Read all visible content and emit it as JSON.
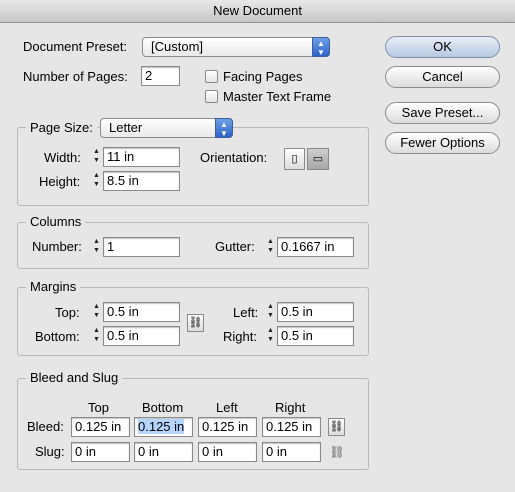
{
  "window": {
    "title": "New Document"
  },
  "document": {
    "preset_label": "Document Preset:",
    "preset_value": "[Custom]",
    "pages_label": "Number of Pages:",
    "pages_value": "2",
    "facing_pages_label": "Facing Pages",
    "facing_pages_checked": false,
    "master_text_frame_label": "Master Text Frame",
    "master_text_frame_checked": false
  },
  "buttons": {
    "ok": "OK",
    "cancel": "Cancel",
    "save_preset": "Save Preset...",
    "fewer_options": "Fewer Options"
  },
  "page_size": {
    "group_title": "Page Size:",
    "value": "Letter",
    "width_label": "Width:",
    "width_value": "11 in",
    "height_label": "Height:",
    "height_value": "8.5 in",
    "orientation_label": "Orientation:",
    "orientation_selected": "landscape"
  },
  "columns": {
    "group_title": "Columns",
    "number_label": "Number:",
    "number_value": "1",
    "gutter_label": "Gutter:",
    "gutter_value": "0.1667 in"
  },
  "margins": {
    "group_title": "Margins",
    "top_label": "Top:",
    "top_value": "0.5 in",
    "bottom_label": "Bottom:",
    "bottom_value": "0.5 in",
    "left_label": "Left:",
    "left_value": "0.5 in",
    "right_label": "Right:",
    "right_value": "0.5 in"
  },
  "bleed_slug": {
    "group_title": "Bleed and Slug",
    "col_top": "Top",
    "col_bottom": "Bottom",
    "col_left": "Left",
    "col_right": "Right",
    "bleed_label": "Bleed:",
    "bleed_top": "0.125 in",
    "bleed_bottom": "0.125 in",
    "bleed_left": "0.125 in",
    "bleed_right": "0.125 in",
    "slug_label": "Slug:",
    "slug_top": "0 in",
    "slug_bottom": "0 in",
    "slug_left": "0 in",
    "slug_right": "0 in"
  },
  "icons": {
    "portrait": "portrait-orientation-icon",
    "landscape": "landscape-orientation-icon",
    "chain": "chain-link-icon",
    "chain_broken": "broken-chain-icon"
  },
  "colors": {
    "selection_highlight": "#b5d5ff",
    "accent": "#2d63c8"
  }
}
